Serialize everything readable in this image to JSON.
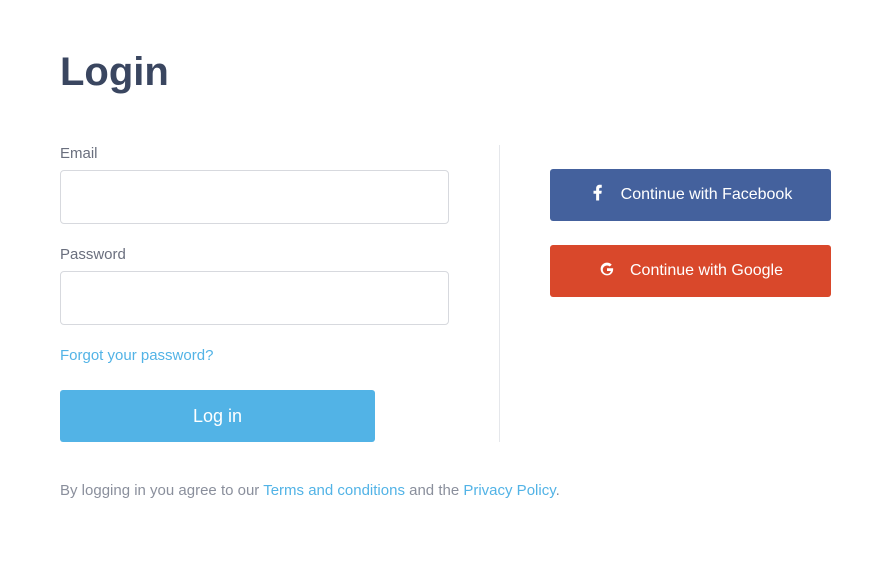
{
  "title": "Login",
  "form": {
    "email_label": "Email",
    "email_value": "",
    "password_label": "Password",
    "password_value": "",
    "forgot_label": "Forgot your password?",
    "login_button": "Log in"
  },
  "social": {
    "facebook_label": "Continue with Facebook",
    "google_label": "Continue with Google"
  },
  "terms": {
    "prefix": "By logging in you agree to our ",
    "terms_link": "Terms and conditions",
    "middle": " and the ",
    "privacy_link": "Privacy Policy",
    "suffix": "."
  },
  "colors": {
    "primary": "#52b3e6",
    "facebook": "#44619d",
    "google": "#d9482b",
    "heading": "#3a4660"
  }
}
